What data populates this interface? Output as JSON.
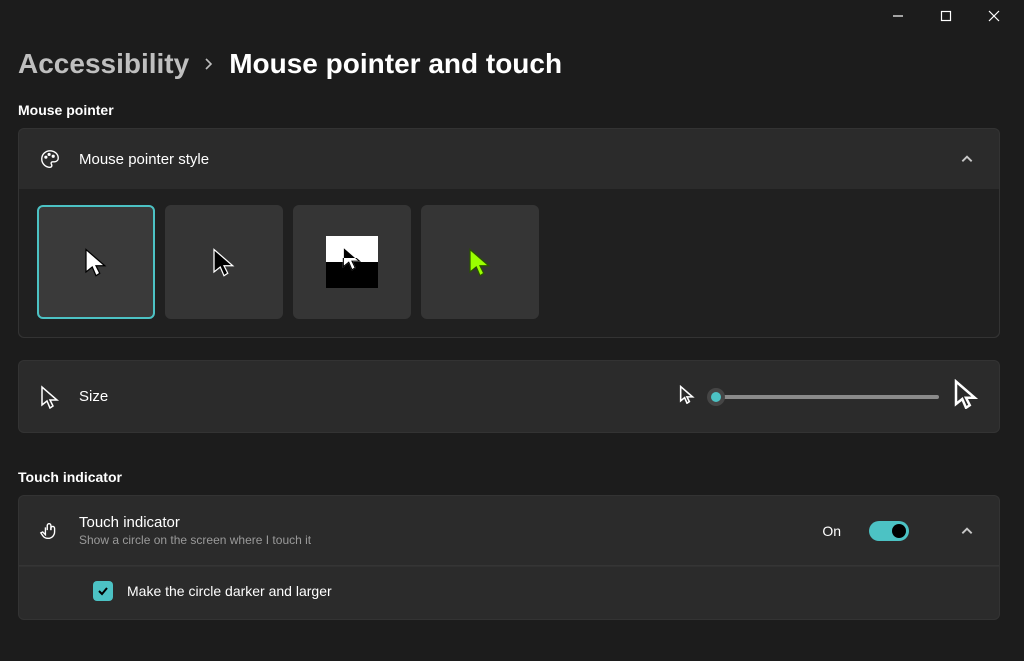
{
  "titlebar": {
    "minimize_title": "Minimize",
    "maximize_title": "Maximize",
    "close_title": "Close"
  },
  "breadcrumb": {
    "parent": "Accessibility",
    "current": "Mouse pointer and touch"
  },
  "mouse_pointer": {
    "section_label": "Mouse pointer",
    "style_header": "Mouse pointer style",
    "styles": [
      {
        "id": "white",
        "name": "White pointer",
        "selected": true
      },
      {
        "id": "black",
        "name": "Black pointer",
        "selected": false
      },
      {
        "id": "inverted",
        "name": "Inverted pointer",
        "selected": false
      },
      {
        "id": "custom",
        "name": "Custom color pointer",
        "selected": false
      }
    ],
    "size_label": "Size",
    "size_value_percent": 3
  },
  "touch": {
    "section_label": "Touch indicator",
    "row_title": "Touch indicator",
    "row_subtitle": "Show a circle on the screen where I touch it",
    "state_label": "On",
    "state_on": true,
    "circle_option_label": "Make the circle darker and larger",
    "circle_option_checked": true
  },
  "colors": {
    "accent": "#4cc2c4"
  }
}
